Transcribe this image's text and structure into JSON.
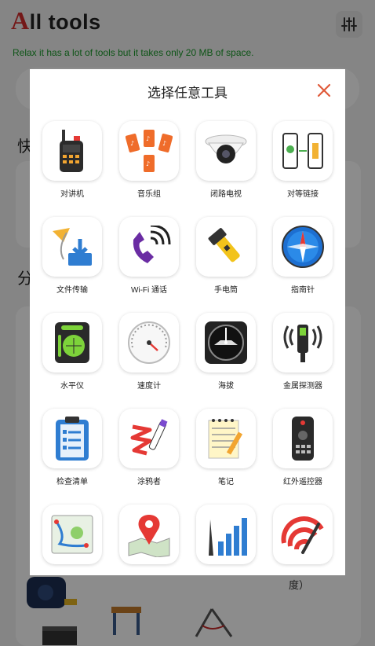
{
  "app": {
    "title_letter": "A",
    "title_rest": "ll tools",
    "subtitle": "Relax it has a lot of tools but it takes only 20 MB of space.",
    "quick_label": "快",
    "category_label": "分",
    "side_text": "度）"
  },
  "modal": {
    "title": "选择任意工具",
    "tools": [
      {
        "label": "对讲机",
        "icon": "walkie-talkie-icon"
      },
      {
        "label": "音乐组",
        "icon": "music-group-icon"
      },
      {
        "label": "闭路电视",
        "icon": "cctv-camera-icon"
      },
      {
        "label": "对等链接",
        "icon": "peer-link-icon"
      },
      {
        "label": "文件传输",
        "icon": "file-transfer-icon"
      },
      {
        "label": "Wi-Fi 通话",
        "icon": "wifi-call-icon"
      },
      {
        "label": "手电筒",
        "icon": "flashlight-icon"
      },
      {
        "label": "指南针",
        "icon": "compass-icon"
      },
      {
        "label": "水平仪",
        "icon": "spirit-level-icon"
      },
      {
        "label": "速度计",
        "icon": "speedometer-icon"
      },
      {
        "label": "海拔",
        "icon": "altimeter-icon"
      },
      {
        "label": "金属探测器",
        "icon": "metal-detector-icon"
      },
      {
        "label": "检查清单",
        "icon": "checklist-icon"
      },
      {
        "label": "涂鸦者",
        "icon": "doodle-icon"
      },
      {
        "label": "笔记",
        "icon": "notes-icon"
      },
      {
        "label": "红外遥控器",
        "icon": "ir-remote-icon"
      },
      {
        "label": "",
        "icon": "route-map-icon"
      },
      {
        "label": "",
        "icon": "map-pin-icon"
      },
      {
        "label": "",
        "icon": "signal-bars-icon"
      },
      {
        "label": "",
        "icon": "wifi-speed-icon"
      }
    ]
  },
  "colors": {
    "accent": "#d32f2f",
    "subtitle": "#1a9a2a",
    "close": "#e05a3a"
  }
}
